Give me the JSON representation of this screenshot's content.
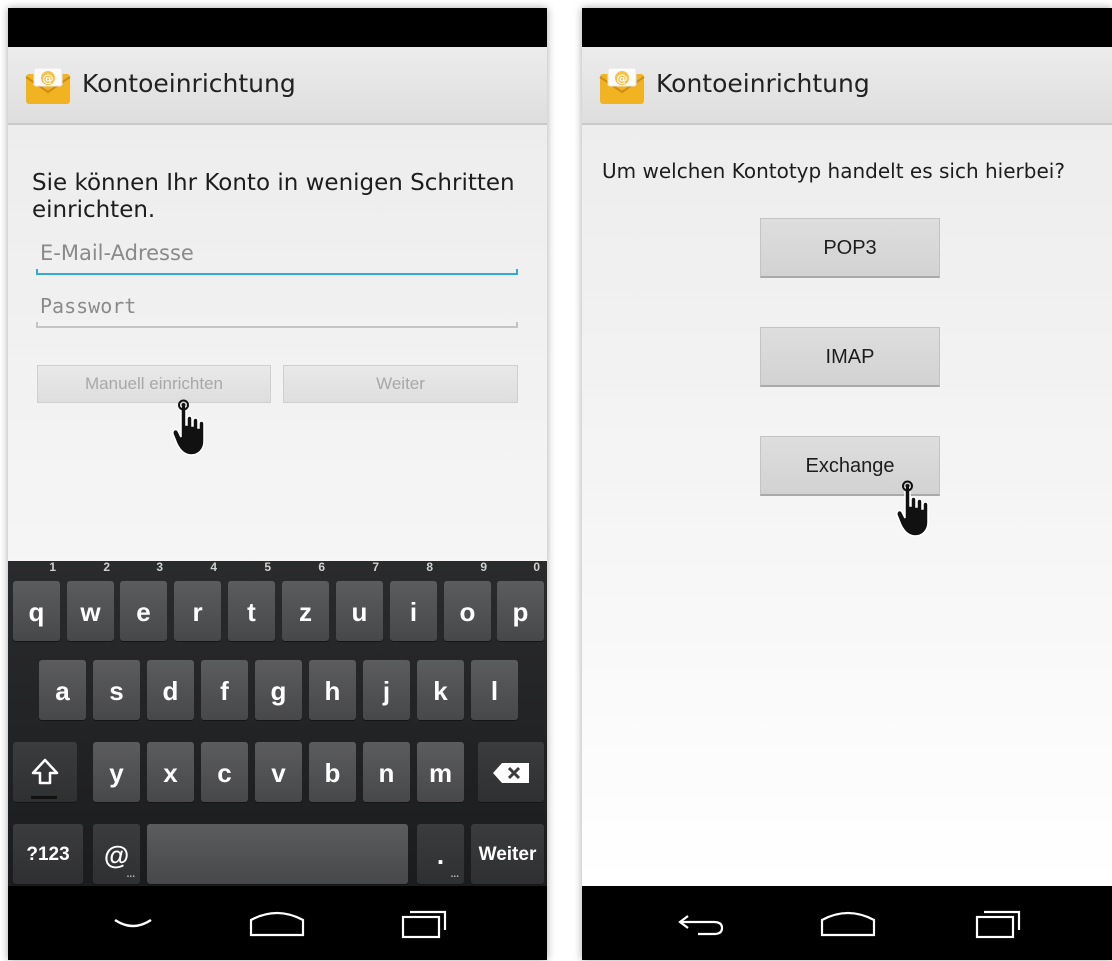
{
  "left_screen": {
    "title": "Kontoeinrichtung",
    "intro_text": "Sie können Ihr Konto in wenigen Schritten einrichten.",
    "email_placeholder": "E-Mail-Adresse",
    "password_placeholder": "Passwort",
    "manual_button": "Manuell einrichten",
    "next_button": "Weiter"
  },
  "keyboard": {
    "row1": [
      {
        "label": "q",
        "hint": "1"
      },
      {
        "label": "w",
        "hint": "2"
      },
      {
        "label": "e",
        "hint": "3"
      },
      {
        "label": "r",
        "hint": "4"
      },
      {
        "label": "t",
        "hint": "5"
      },
      {
        "label": "z",
        "hint": "6"
      },
      {
        "label": "u",
        "hint": "7"
      },
      {
        "label": "i",
        "hint": "8"
      },
      {
        "label": "o",
        "hint": "9"
      },
      {
        "label": "p",
        "hint": "0"
      }
    ],
    "row2": [
      "a",
      "s",
      "d",
      "f",
      "g",
      "h",
      "j",
      "k",
      "l"
    ],
    "row3": [
      "y",
      "x",
      "c",
      "v",
      "b",
      "n",
      "m"
    ],
    "symbols_key": "?123",
    "at_key": "@",
    "period_key": ".",
    "enter_key": "Weiter",
    "shift_icon": "shift-arrow-icon",
    "backspace_icon": "backspace-icon"
  },
  "right_screen": {
    "title": "Kontoeinrichtung",
    "question": "Um welchen Kontotyp handelt es sich hierbei?",
    "options": [
      "POP3",
      "IMAP",
      "Exchange"
    ]
  },
  "colors": {
    "focus_underline": "#33a9d8",
    "status_bar": "#000000",
    "keyboard_bg": "#222325",
    "key_bg": "#525355"
  },
  "icons": {
    "app": "email-envelope-icon",
    "cursor": "hand-pointer-icon",
    "nav_left_left": "hide-keyboard-icon",
    "nav_left_right": "back-icon",
    "nav_home": "home-icon",
    "nav_recent": "recent-apps-icon"
  }
}
